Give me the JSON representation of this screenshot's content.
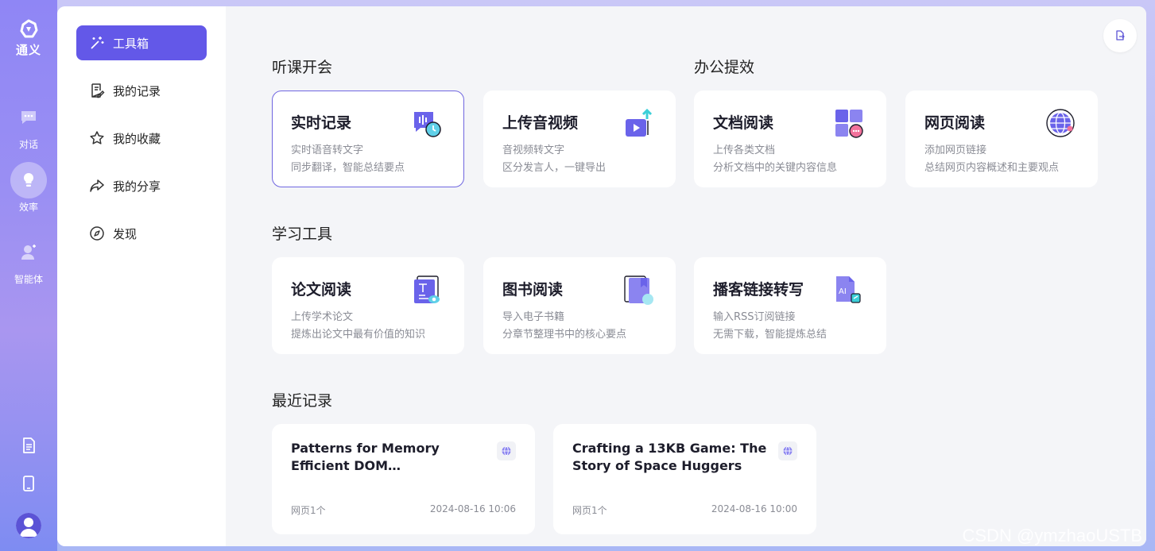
{
  "brand": {
    "name": "通义"
  },
  "rail": {
    "items": [
      {
        "label": "对话"
      },
      {
        "label": "效率"
      },
      {
        "label": "智能体"
      }
    ]
  },
  "sidenav": {
    "items": [
      {
        "label": "工具箱"
      },
      {
        "label": "我的记录"
      },
      {
        "label": "我的收藏"
      },
      {
        "label": "我的分享"
      },
      {
        "label": "发现"
      }
    ]
  },
  "sections": {
    "listen": "听课开会",
    "office": "办公提效",
    "study": "学习工具",
    "recent": "最近记录"
  },
  "tools": [
    {
      "title": "实时记录",
      "line1": "实时语音转文字",
      "line2": "同步翻译，智能总结要点"
    },
    {
      "title": "上传音视频",
      "line1": "音视频转文字",
      "line2": "区分发言人，一键导出"
    },
    {
      "title": "文档阅读",
      "line1": "上传各类文档",
      "line2": "分析文档中的关键内容信息"
    },
    {
      "title": "网页阅读",
      "line1": "添加网页链接",
      "line2": "总结网页内容概述和主要观点"
    },
    {
      "title": "论文阅读",
      "line1": "上传学术论文",
      "line2": "提炼出论文中最有价值的知识"
    },
    {
      "title": "图书阅读",
      "line1": "导入电子书籍",
      "line2": "分章节整理书中的核心要点"
    },
    {
      "title": "播客链接转写",
      "line1": "输入RSS订阅链接",
      "line2": "无需下载，智能提炼总结"
    }
  ],
  "recent": [
    {
      "title": "Patterns for Memory Efficient DOM Manipulatio...",
      "type": "网页1个",
      "time": "2024-08-16 10:06"
    },
    {
      "title": "Crafting a 13KB Game: The Story of Space Huggers",
      "type": "网页1个",
      "time": "2024-08-16 10:00"
    }
  ],
  "watermark": "CSDN @ymzhaoUSTB",
  "colors": {
    "accent": "#6358e8",
    "rail": "#8f86f5",
    "background": "#f4f5f8"
  }
}
